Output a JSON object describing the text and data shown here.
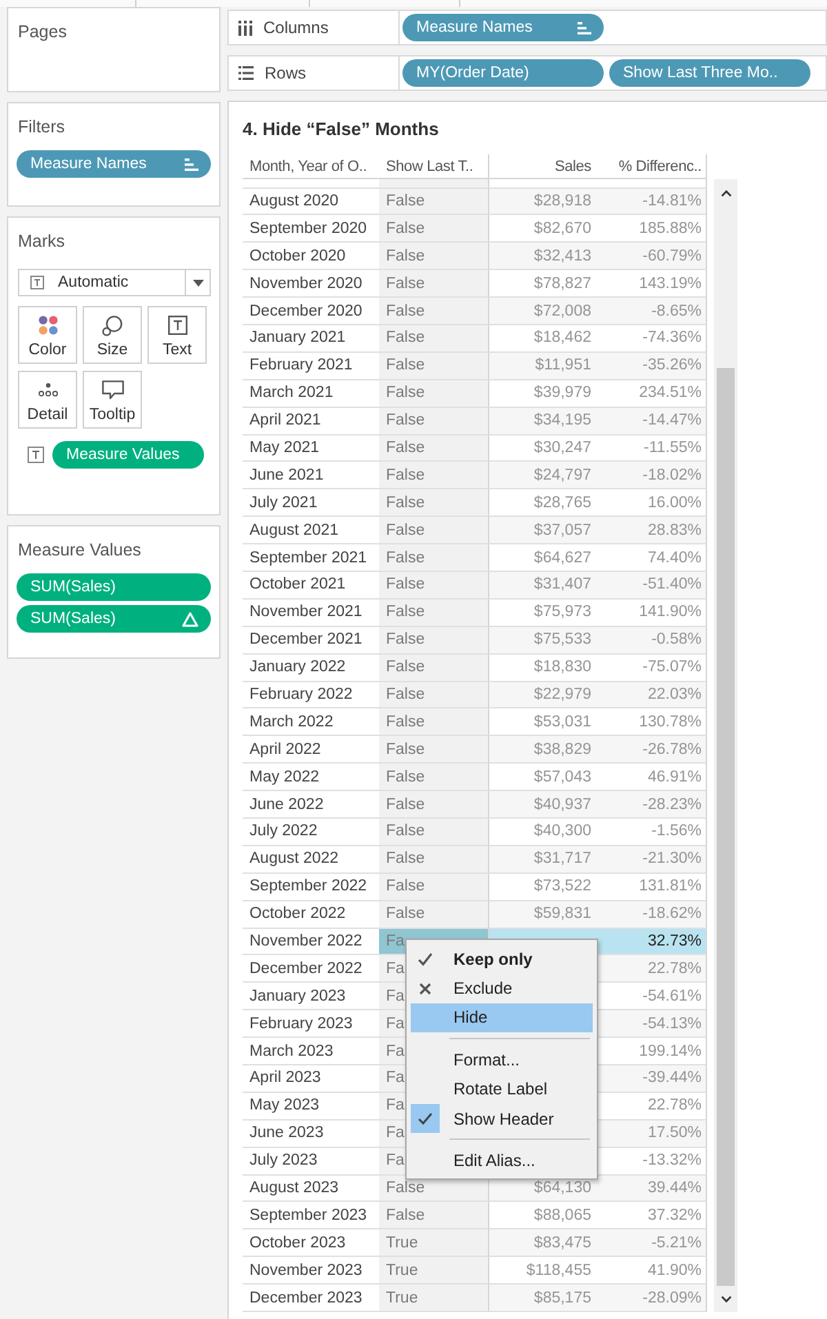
{
  "left_panel": {
    "pages": {
      "title": "Pages"
    },
    "filters": {
      "title": "Filters",
      "pills": [
        {
          "label": "Measure Names",
          "kind": "discrete",
          "sorted": true
        }
      ]
    },
    "marks": {
      "title": "Marks",
      "mark_type": "Automatic",
      "buttons": [
        {
          "kind": "color",
          "label": "Color"
        },
        {
          "kind": "size",
          "label": "Size"
        },
        {
          "kind": "text",
          "label": "Text"
        },
        {
          "kind": "detail",
          "label": "Detail"
        },
        {
          "kind": "tooltip",
          "label": "Tooltip"
        }
      ],
      "encodings": [
        {
          "kind": "text",
          "field": {
            "label": "Measure Values",
            "kind": "continuous"
          }
        }
      ]
    },
    "measure_values": {
      "title": "Measure Values",
      "pills": [
        {
          "label": "SUM(Sales)",
          "kind": "continuous",
          "table_calc": false
        },
        {
          "label": "SUM(Sales)",
          "kind": "continuous",
          "table_calc": true
        }
      ]
    }
  },
  "shelves": [
    {
      "kind": "columns",
      "label": "Columns",
      "pills": [
        {
          "label": "Measure Names",
          "kind": "discrete",
          "sorted": true
        }
      ]
    },
    {
      "kind": "rows",
      "label": "Rows",
      "pills": [
        {
          "label": "MY(Order Date)",
          "kind": "discrete",
          "sorted": false
        },
        {
          "label": "Show Last Three Mo..",
          "kind": "discrete",
          "sorted": false
        }
      ]
    }
  ],
  "view": {
    "title": "4. Hide “False” Months",
    "columns": [
      "Month, Year of O..",
      "Show Last T..",
      "Sales",
      "% Differenc.."
    ],
    "rows": [
      {
        "month": "August 2020",
        "show_last": "False",
        "sales": "$28,918",
        "difference": "-14.81%",
        "selected": false
      },
      {
        "month": "September 2020",
        "show_last": "False",
        "sales": "$82,670",
        "difference": "185.88%",
        "selected": false
      },
      {
        "month": "October 2020",
        "show_last": "False",
        "sales": "$32,413",
        "difference": "-60.79%",
        "selected": false
      },
      {
        "month": "November 2020",
        "show_last": "False",
        "sales": "$78,827",
        "difference": "143.19%",
        "selected": false
      },
      {
        "month": "December 2020",
        "show_last": "False",
        "sales": "$72,008",
        "difference": "-8.65%",
        "selected": false
      },
      {
        "month": "January 2021",
        "show_last": "False",
        "sales": "$18,462",
        "difference": "-74.36%",
        "selected": false
      },
      {
        "month": "February 2021",
        "show_last": "False",
        "sales": "$11,951",
        "difference": "-35.26%",
        "selected": false
      },
      {
        "month": "March 2021",
        "show_last": "False",
        "sales": "$39,979",
        "difference": "234.51%",
        "selected": false
      },
      {
        "month": "April 2021",
        "show_last": "False",
        "sales": "$34,195",
        "difference": "-14.47%",
        "selected": false
      },
      {
        "month": "May 2021",
        "show_last": "False",
        "sales": "$30,247",
        "difference": "-11.55%",
        "selected": false
      },
      {
        "month": "June 2021",
        "show_last": "False",
        "sales": "$24,797",
        "difference": "-18.02%",
        "selected": false
      },
      {
        "month": "July 2021",
        "show_last": "False",
        "sales": "$28,765",
        "difference": "16.00%",
        "selected": false
      },
      {
        "month": "August 2021",
        "show_last": "False",
        "sales": "$37,057",
        "difference": "28.83%",
        "selected": false
      },
      {
        "month": "September 2021",
        "show_last": "False",
        "sales": "$64,627",
        "difference": "74.40%",
        "selected": false
      },
      {
        "month": "October 2021",
        "show_last": "False",
        "sales": "$31,407",
        "difference": "-51.40%",
        "selected": false
      },
      {
        "month": "November 2021",
        "show_last": "False",
        "sales": "$75,973",
        "difference": "141.90%",
        "selected": false
      },
      {
        "month": "December 2021",
        "show_last": "False",
        "sales": "$75,533",
        "difference": "-0.58%",
        "selected": false
      },
      {
        "month": "January 2022",
        "show_last": "False",
        "sales": "$18,830",
        "difference": "-75.07%",
        "selected": false
      },
      {
        "month": "February 2022",
        "show_last": "False",
        "sales": "$22,979",
        "difference": "22.03%",
        "selected": false
      },
      {
        "month": "March 2022",
        "show_last": "False",
        "sales": "$53,031",
        "difference": "130.78%",
        "selected": false
      },
      {
        "month": "April 2022",
        "show_last": "False",
        "sales": "$38,829",
        "difference": "-26.78%",
        "selected": false
      },
      {
        "month": "May 2022",
        "show_last": "False",
        "sales": "$57,043",
        "difference": "46.91%",
        "selected": false
      },
      {
        "month": "June 2022",
        "show_last": "False",
        "sales": "$40,937",
        "difference": "-28.23%",
        "selected": false
      },
      {
        "month": "July 2022",
        "show_last": "False",
        "sales": "$40,300",
        "difference": "-1.56%",
        "selected": false
      },
      {
        "month": "August 2022",
        "show_last": "False",
        "sales": "$31,717",
        "difference": "-21.30%",
        "selected": false
      },
      {
        "month": "September 2022",
        "show_last": "False",
        "sales": "$73,522",
        "difference": "131.81%",
        "selected": false
      },
      {
        "month": "October 2022",
        "show_last": "False",
        "sales": "$59,831",
        "difference": "-18.62%",
        "selected": false
      },
      {
        "month": "November 2022",
        "show_last": "Fa",
        "difference": "32.73%",
        "selected": true
      },
      {
        "month": "December 2022",
        "show_last": "Fa",
        "difference": "22.78%",
        "selected": false
      },
      {
        "month": "January 2023",
        "show_last": "Fa",
        "difference": "-54.61%",
        "selected": false
      },
      {
        "month": "February 2023",
        "show_last": "Fa",
        "difference": "-54.13%",
        "selected": false
      },
      {
        "month": "March 2023",
        "show_last": "Fa",
        "difference": "199.14%",
        "selected": false
      },
      {
        "month": "April 2023",
        "show_last": "Fa",
        "difference": "-39.44%",
        "selected": false
      },
      {
        "month": "May 2023",
        "show_last": "Fa",
        "difference": "22.78%",
        "selected": false
      },
      {
        "month": "June 2023",
        "show_last": "Fa",
        "difference": "17.50%",
        "selected": false
      },
      {
        "month": "July 2023",
        "show_last": "Fa",
        "difference": "-13.32%",
        "selected": false
      },
      {
        "month": "August 2023",
        "show_last": "False",
        "sales": "$64,130",
        "difference": "39.44%",
        "selected": false
      },
      {
        "month": "September 2023",
        "show_last": "False",
        "sales": "$88,065",
        "difference": "37.32%",
        "selected": false
      },
      {
        "month": "October 2023",
        "show_last": "True",
        "sales": "$83,475",
        "difference": "-5.21%",
        "selected": false
      },
      {
        "month": "November 2023",
        "show_last": "True",
        "sales": "$118,455",
        "difference": "41.90%",
        "selected": false
      },
      {
        "month": "December 2023",
        "show_last": "True",
        "sales": "$85,175",
        "difference": "-28.09%",
        "selected": false
      }
    ]
  },
  "context_menu": {
    "groups": [
      {
        "items": [
          {
            "kind": "keep",
            "label": "Keep only",
            "selected": false
          },
          {
            "kind": "exclude",
            "label": "Exclude",
            "selected": false
          },
          {
            "kind": "plain",
            "label": "Hide",
            "selected": true
          }
        ]
      },
      {
        "items": [
          {
            "kind": "plain",
            "label": "Format...",
            "selected": false
          },
          {
            "kind": "plain",
            "label": "Rotate Label",
            "selected": false
          },
          {
            "kind": "toggle",
            "label": "Show Header",
            "checked": true,
            "selected": false
          }
        ]
      },
      {
        "items": [
          {
            "kind": "plain",
            "label": "Edit Alias...",
            "selected": false
          }
        ]
      }
    ]
  }
}
